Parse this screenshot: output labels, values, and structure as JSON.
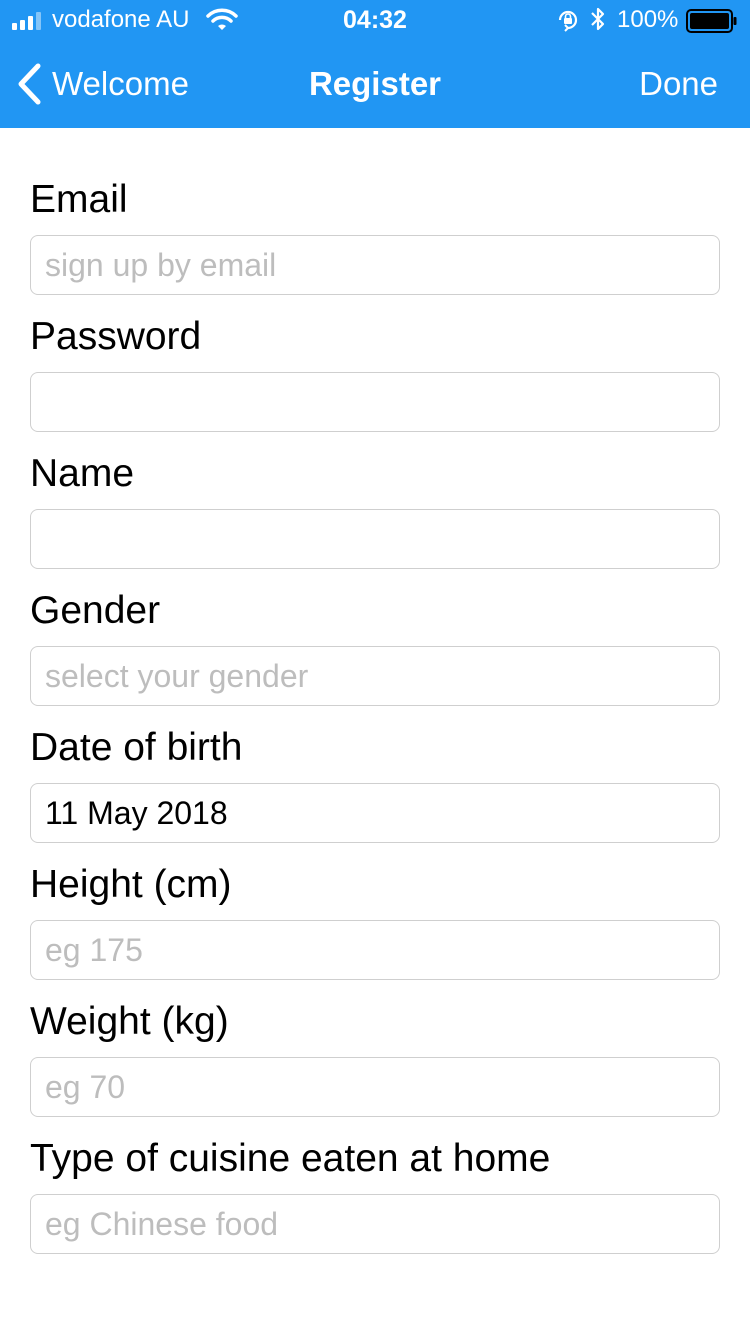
{
  "status_bar": {
    "carrier": "vodafone AU",
    "time": "04:32",
    "battery": "100%"
  },
  "nav": {
    "back_label": "Welcome",
    "title": "Register",
    "done_label": "Done"
  },
  "colors": {
    "accent": "#2196f3"
  },
  "form": {
    "fields": [
      {
        "label": "Email",
        "value": "",
        "placeholder": "sign up by email"
      },
      {
        "label": "Password",
        "value": "",
        "placeholder": ""
      },
      {
        "label": "Name",
        "value": "",
        "placeholder": ""
      },
      {
        "label": "Gender",
        "value": "",
        "placeholder": "select your gender"
      },
      {
        "label": "Date of birth",
        "value": "11 May 2018",
        "placeholder": ""
      },
      {
        "label": "Height (cm)",
        "value": "",
        "placeholder": "eg 175"
      },
      {
        "label": "Weight (kg)",
        "value": "",
        "placeholder": "eg 70"
      },
      {
        "label": "Type of cuisine eaten at home",
        "value": "",
        "placeholder": "eg Chinese food"
      }
    ]
  }
}
